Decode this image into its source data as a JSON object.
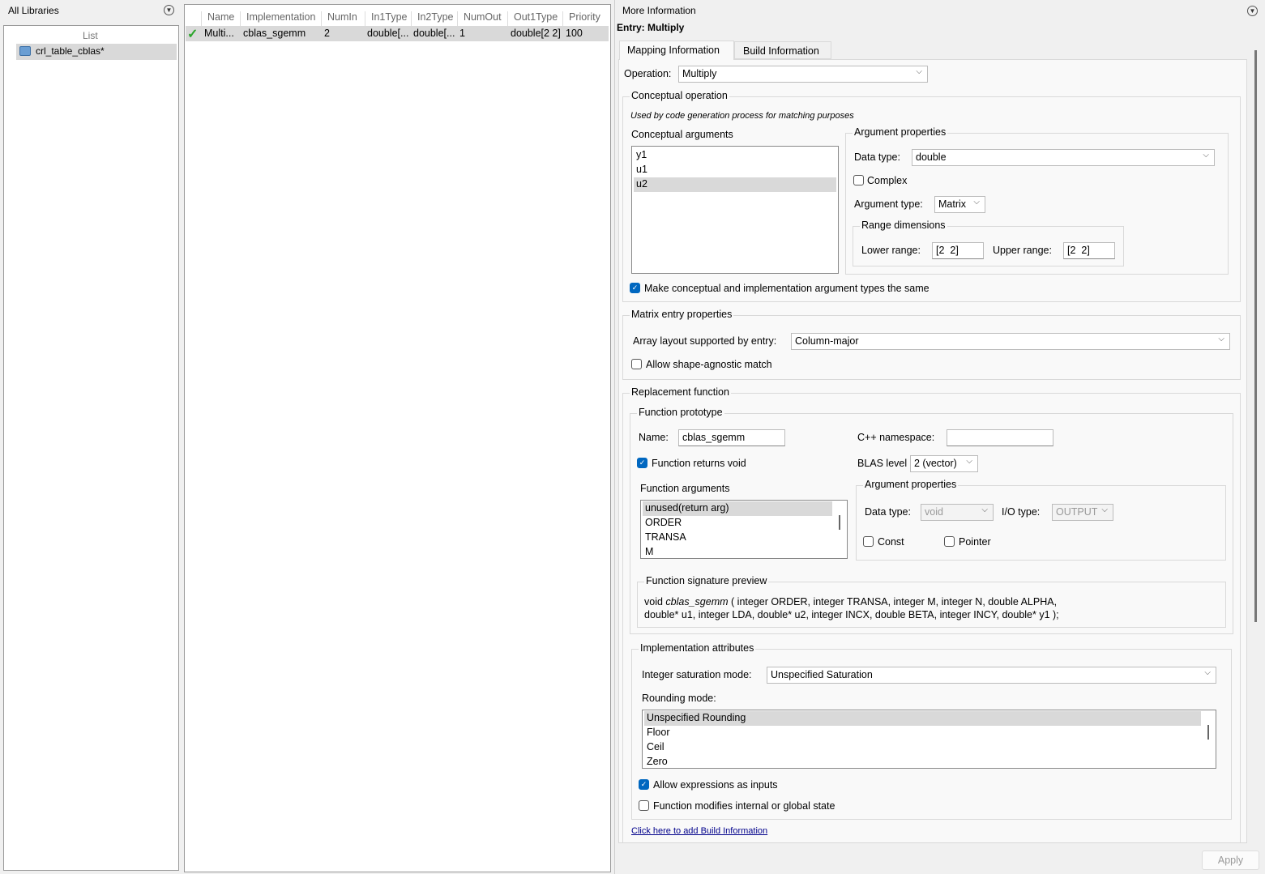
{
  "left": {
    "title": "All Libraries",
    "list_header": "List",
    "items": [
      {
        "label": "crl_table_cblas*"
      }
    ]
  },
  "table": {
    "columns": [
      "Name",
      "Implementation",
      "NumIn",
      "In1Type",
      "In2Type",
      "NumOut",
      "Out1Type",
      "Priority"
    ],
    "rows": [
      {
        "status": "valid",
        "cells": [
          "Multi...",
          "cblas_sgemm",
          "2",
          "double[...",
          "double[...",
          "1",
          "double[2 2]",
          "100"
        ]
      }
    ]
  },
  "right": {
    "title": "More Information",
    "entry": "Entry: Multiply",
    "tabs": [
      {
        "label": "Mapping Information",
        "active": true
      },
      {
        "label": "Build Information",
        "active": false
      }
    ],
    "operation_label": "Operation:",
    "operation": "Multiply",
    "conceptual": {
      "title": "Conceptual operation",
      "note": "Used by code generation process for matching purposes",
      "args_label": "Conceptual arguments",
      "args": [
        "y1",
        "u1",
        "u2"
      ],
      "selected": "u2",
      "props_title": "Argument properties",
      "data_type_label": "Data type:",
      "data_type": "double",
      "complex_label": "Complex",
      "complex": false,
      "arg_type_label": "Argument type:",
      "arg_type": "Matrix",
      "range_title": "Range dimensions",
      "lower_label": "Lower range:",
      "lower": "[2  2]",
      "upper_label": "Upper range:",
      "upper": "[2  2]",
      "same_label": "Make conceptual and implementation argument types the same",
      "same": true
    },
    "matrix": {
      "title": "Matrix entry properties",
      "layout_label": "Array layout supported by entry:",
      "layout": "Column-major",
      "agnostic_label": "Allow shape-agnostic match",
      "agnostic": false
    },
    "replacement": {
      "title": "Replacement function",
      "proto_title": "Function prototype",
      "name_label": "Name:",
      "name": "cblas_sgemm",
      "ns_label": "C++ namespace:",
      "ns": "",
      "void_label": "Function returns void",
      "void": true,
      "blas_label": "BLAS level",
      "blas": "2 (vector)",
      "args_label": "Function arguments",
      "args": [
        "unused(return arg)",
        "ORDER",
        "TRANSA",
        "M"
      ],
      "props_title": "Argument properties",
      "data_type_label": "Data type:",
      "data_type": "void",
      "io_label": "I/O type:",
      "io": "OUTPUT",
      "const_label": "Const",
      "pointer_label": "Pointer",
      "sig_title": "Function signature preview",
      "sig_void": "void",
      "sig_name": "cblas_sgemm",
      "sig_line1": "( integer ORDER, integer TRANSA, integer M, integer N, double ALPHA,",
      "sig_line2": "double* u1, integer LDA, double* u2, integer INCX, double BETA, integer INCY, double* y1 );"
    },
    "impl": {
      "title": "Implementation attributes",
      "sat_label": "Integer saturation mode:",
      "sat": "Unspecified Saturation",
      "round_label": "Rounding mode:",
      "round": [
        "Unspecified Rounding",
        "Floor",
        "Ceil",
        "Zero"
      ],
      "expr_label": "Allow expressions as inputs",
      "expr": true,
      "modifies_label": "Function modifies internal or global state",
      "modifies": false
    },
    "link": "Click here to add Build Information",
    "apply": "Apply"
  }
}
